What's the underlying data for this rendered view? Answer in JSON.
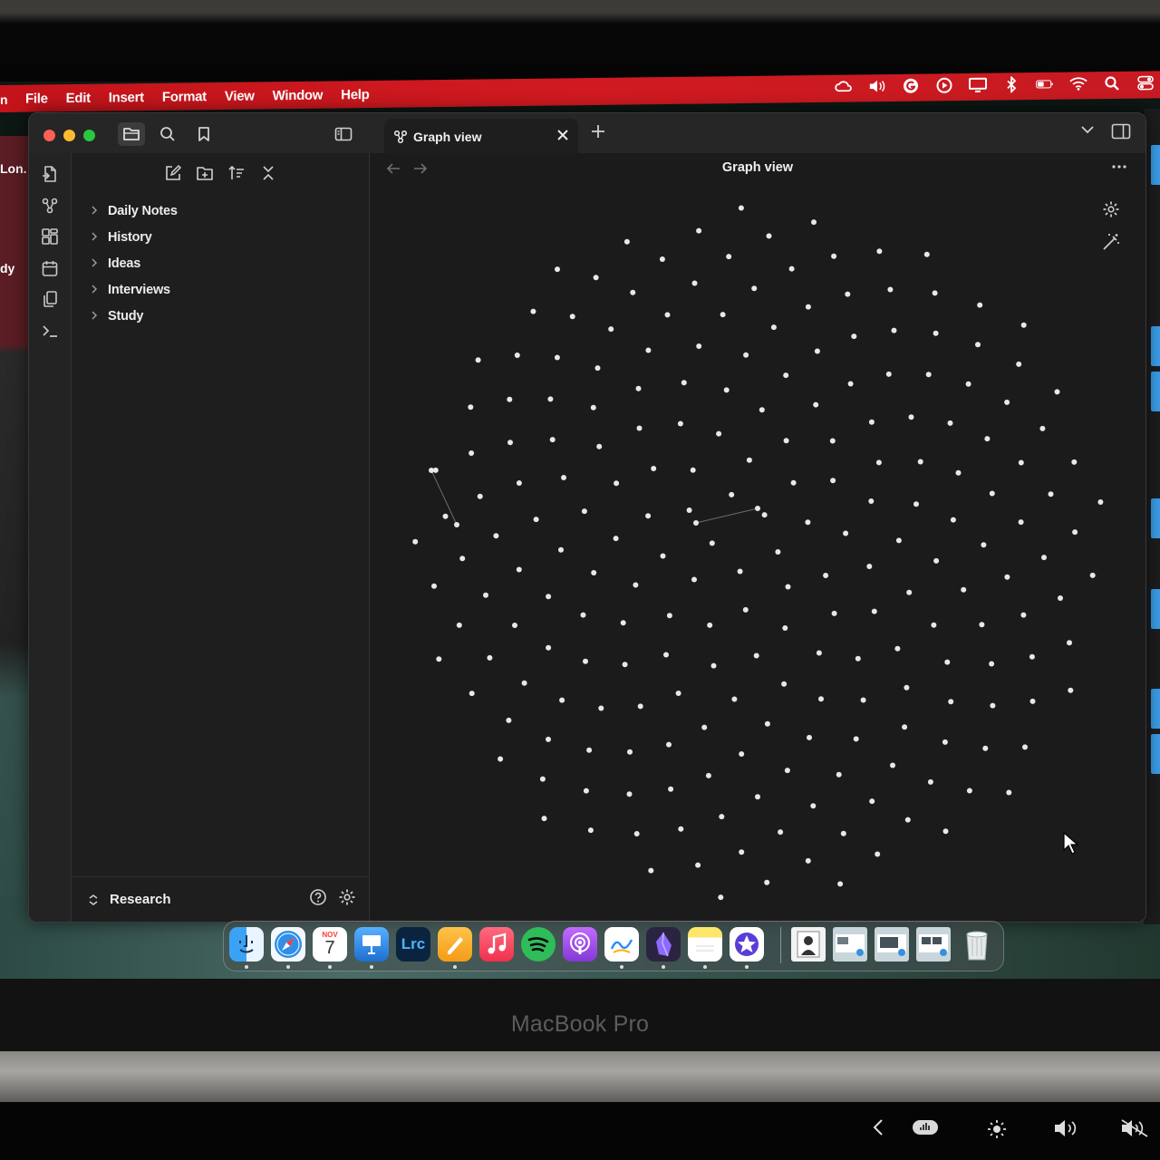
{
  "menubar": {
    "app_fragment": "n",
    "menus": [
      "File",
      "Edit",
      "Insert",
      "Format",
      "View",
      "Window",
      "Help"
    ],
    "status_icons": [
      "creative-cloud-icon",
      "volume-icon",
      "grammarly-icon",
      "play-icon",
      "display-icon",
      "bluetooth-icon",
      "battery-icon",
      "wifi-icon",
      "spotlight-search-icon",
      "control-center-icon"
    ]
  },
  "wallpaper": {
    "left_text_1": "Lon.",
    "left_text_2": "dy"
  },
  "tab": {
    "title": "Graph view",
    "icon": "graph-icon"
  },
  "explorer": {
    "folders": [
      "Daily Notes",
      "History",
      "Ideas",
      "Interviews",
      "Study"
    ],
    "vault_name": "Research"
  },
  "ribbon": {
    "icons": [
      "open-quick-switcher-icon",
      "graph-view-icon",
      "canvas-icon",
      "daily-note-calendar-icon",
      "templates-icon",
      "command-palette-icon"
    ]
  },
  "graph": {
    "title": "Graph view",
    "node_count": 220,
    "edge_count": 2,
    "node_color": "#e8e8e8",
    "edge_color": "#6b6b6b"
  },
  "dock": {
    "apps": [
      {
        "name": "Finder",
        "color": "#2f8be6",
        "running": true
      },
      {
        "name": "Safari",
        "color": "#3a8fe0",
        "running": true
      },
      {
        "name": "Calendar",
        "color": "#ffffff",
        "month": "NOV",
        "day": "7",
        "running": true
      },
      {
        "name": "Keynote",
        "color": "#2a7fd8",
        "running": true
      },
      {
        "name": "Lightroom Classic",
        "label": "Lrc",
        "color": "#0a2440",
        "running": false
      },
      {
        "name": "Pages",
        "color": "#f6a623",
        "running": true
      },
      {
        "name": "Music",
        "color": "#f0405a",
        "running": false
      },
      {
        "name": "Spotify",
        "color": "#2ebd59",
        "running": false
      },
      {
        "name": "Podcasts",
        "color": "#9a4fd6",
        "running": false
      },
      {
        "name": "Freeform",
        "color": "#ffffff",
        "running": true
      },
      {
        "name": "Obsidian",
        "color": "#2a2440",
        "running": true
      },
      {
        "name": "Notes",
        "color": "#fde66a",
        "running": true
      },
      {
        "name": "iMovie",
        "color": "#ffffff",
        "running": true
      }
    ]
  },
  "laptop": {
    "brand": "MacBook Pro"
  }
}
